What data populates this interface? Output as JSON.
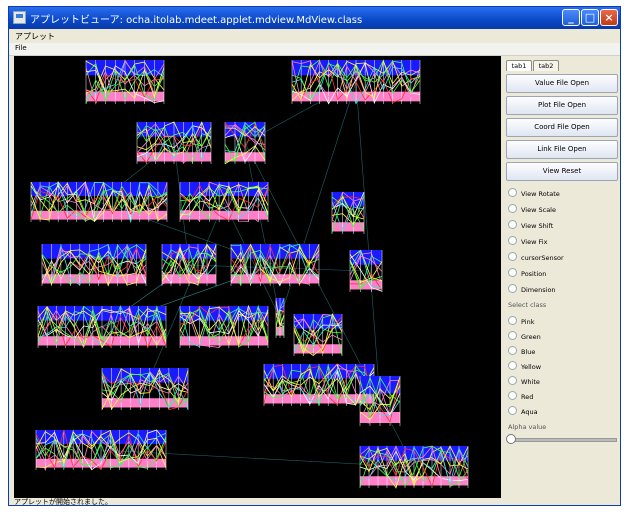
{
  "window": {
    "title": "アプレットビューア: ocha.itolab.mdeet.applet.mdview.MdView.class",
    "menu_top": "アプレット",
    "menu_file": "File",
    "status": "アプレットが開始されました。"
  },
  "panel": {
    "tabs": [
      {
        "label": "tab1"
      },
      {
        "label": "tab2"
      }
    ],
    "buttons": [
      {
        "label": "Value File Open"
      },
      {
        "label": "Plot File Open"
      },
      {
        "label": "Coord File Open"
      },
      {
        "label": "Link File Open"
      },
      {
        "label": "View Reset"
      }
    ],
    "view_options": [
      {
        "label": "View Rotate"
      },
      {
        "label": "View Scale"
      },
      {
        "label": "View Shift"
      },
      {
        "label": "View Fix"
      },
      {
        "label": "cursorSensor"
      },
      {
        "label": "Position"
      },
      {
        "label": "Dimension"
      }
    ],
    "select_class_label": "Select class",
    "classes": [
      {
        "label": "Pink"
      },
      {
        "label": "Green"
      },
      {
        "label": "Blue"
      },
      {
        "label": "Yellow"
      },
      {
        "label": "White"
      },
      {
        "label": "Red"
      },
      {
        "label": "Aqua"
      }
    ],
    "alpha_label": "Alpha value",
    "alpha_value": 0
  },
  "colors": {
    "pink": "#ff7fc8",
    "green": "#40ff40",
    "blue": "#1a1aff",
    "yellow": "#ffff40",
    "white": "#ffffff",
    "red": "#ff3030",
    "aqua": "#40e0e0"
  }
}
